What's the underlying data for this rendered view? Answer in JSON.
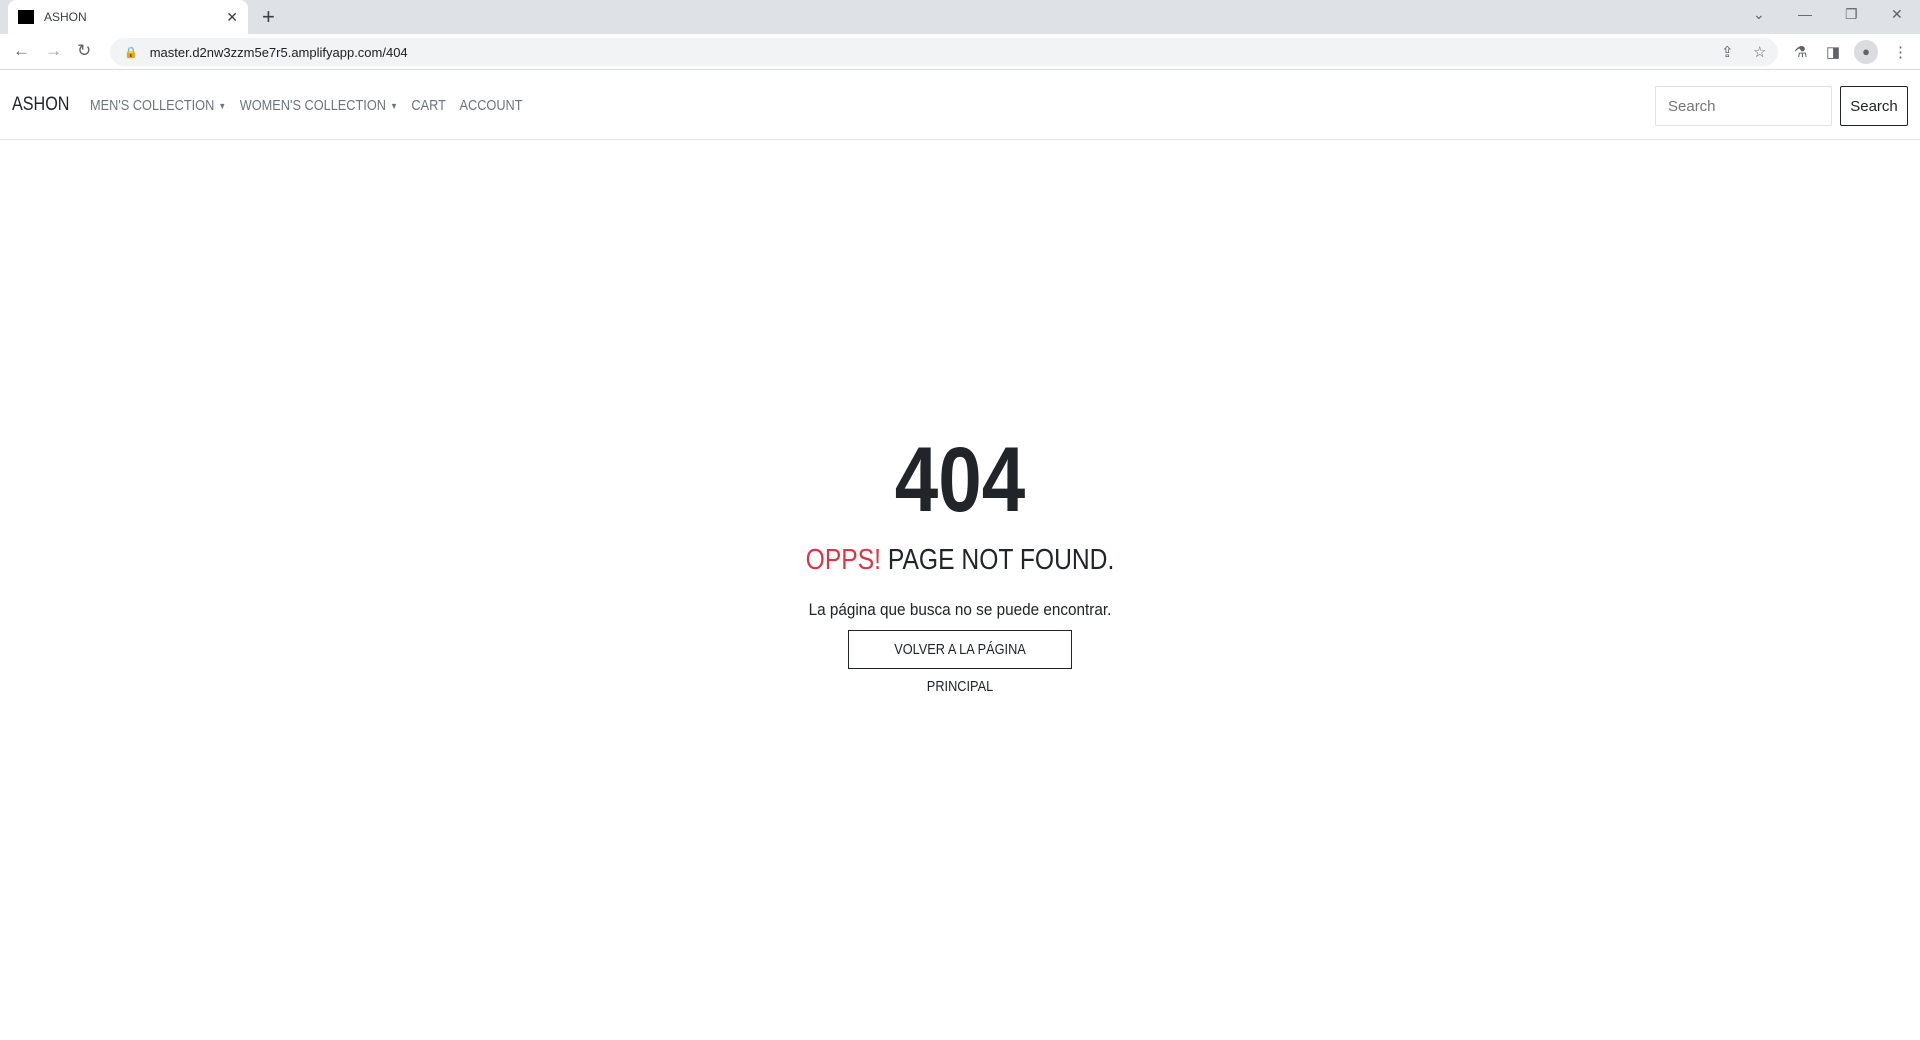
{
  "browser": {
    "tab_title": "ASHON",
    "url": "master.d2nw3zzm5e7r5.amplifyapp.com/404"
  },
  "navbar": {
    "brand": "ASHON",
    "links": [
      {
        "label": "MEN'S COLLECTION"
      },
      {
        "label": "WOMEN'S COLLECTION"
      },
      {
        "label": "CART"
      },
      {
        "label": "ACCOUNT"
      }
    ],
    "search_placeholder": "Search",
    "search_button": "Search"
  },
  "error": {
    "code": "404",
    "oops": "OPPS!",
    "title": "PAGE NOT FOUND.",
    "message": "La página que busca no se puede encontrar.",
    "button": "VOLVER A LA PÁGINA PRINCIPAL"
  },
  "colors": {
    "accent": "#dc3545",
    "text": "#212529"
  }
}
